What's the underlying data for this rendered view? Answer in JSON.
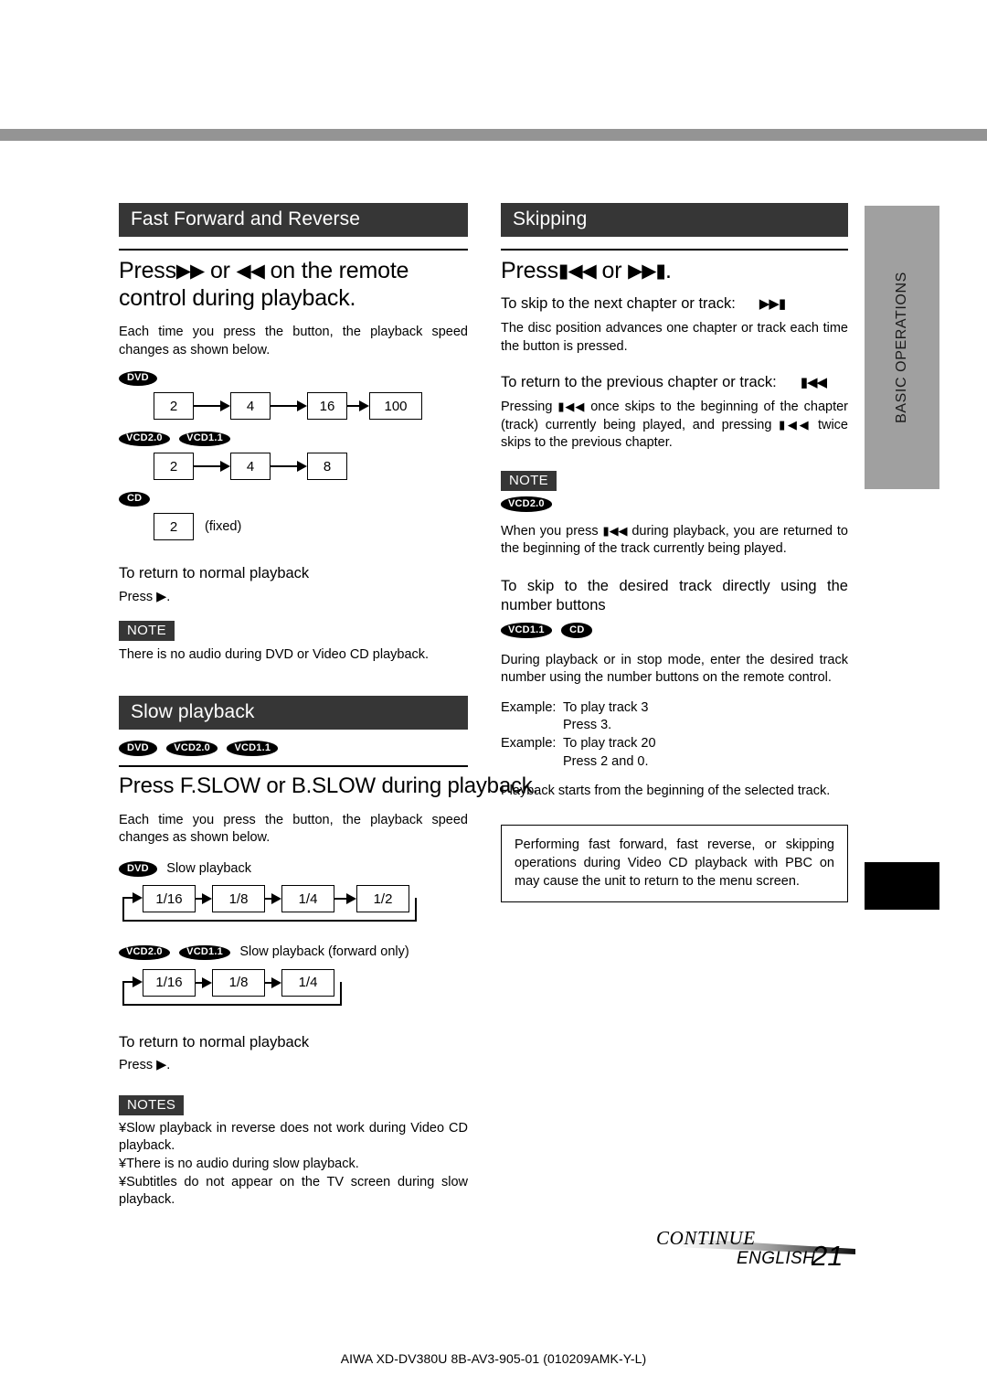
{
  "page": {
    "side_tab_label": "BASIC OPERATIONS",
    "continue_label": "CONTINUE",
    "language_label": "ENGLISH",
    "page_number": "21",
    "footer_code": "AIWA XD-DV380U 8B-AV3-905-01 (010209AMK-Y-L)",
    "accent_dark": "#363636",
    "accent_gray": "#a0a0a0",
    "band_gray": "#949494"
  },
  "left_column": {
    "section1": {
      "title": "Fast Forward and Reverse",
      "headline_prefix": "Press",
      "headline_icon1": "▶▶",
      "headline_mid": " or ",
      "headline_icon2": "◀◀",
      "headline_suffix": " on the remote control during playback.",
      "intro": "Each time you press the button, the playback speed changes as shown below.",
      "diagrams": [
        {
          "badges": [
            "DVD"
          ],
          "steps": [
            "2",
            "4",
            "16",
            "100"
          ],
          "suffix": ""
        },
        {
          "badges": [
            "VCD2.0",
            "VCD1.1"
          ],
          "steps": [
            "2",
            "4",
            "8"
          ],
          "suffix": ""
        },
        {
          "badges": [
            "CD"
          ],
          "steps": [
            "2"
          ],
          "suffix": "(fixed)"
        }
      ],
      "return_heading": "To return to normal playback",
      "return_text": "Press ▶.",
      "note_tag": "NOTE",
      "note_text": "There is no audio during DVD or Video CD playback."
    },
    "section2": {
      "title": "Slow playback",
      "badges": [
        "DVD",
        "VCD2.0",
        "VCD1.1"
      ],
      "headline": "Press F.SLOW or B.SLOW during playback.",
      "intro": "Each time you press the button, the playback speed changes as shown below.",
      "diagram1": {
        "badges": [
          "DVD"
        ],
        "label": "Slow playback",
        "steps": [
          "1/16",
          "1/8",
          "1/4",
          "1/2"
        ]
      },
      "diagram2": {
        "badges": [
          "VCD2.0",
          "VCD1.1"
        ],
        "label": "Slow playback (forward only)",
        "steps": [
          "1/16",
          "1/8",
          "1/4"
        ]
      },
      "return_heading": "To return to normal playback",
      "return_text": "Press ▶.",
      "notes_tag": "NOTES",
      "notes": [
        "Slow playback in reverse does not work during Video CD playback.",
        "There is no audio during slow playback.",
        "Subtitles do not appear on the TV screen during slow playback."
      ],
      "note_bullet": "¥"
    }
  },
  "right_column": {
    "section": {
      "title": "Skipping",
      "headline_prefix": "Press",
      "headline_icon1": "▮◀◀",
      "headline_mid": " or ",
      "headline_icon2": "▶▶▮",
      "headline_suffix": ".",
      "next_heading": "To skip to the next chapter or track:",
      "next_icon": "▶▶▮",
      "next_text": "The disc position advances one chapter or track each time the button is pressed.",
      "prev_heading": "To return to the previous chapter or track:",
      "prev_icon": "▮◀◀",
      "prev_text_a": "Pressing ",
      "prev_icon_inline": "▮◀◀",
      "prev_text_b": " once skips to the beginning of the chapter (track) currently being played, and pressing ",
      "prev_text_c": " twice skips to the previous chapter.",
      "note_tag": "NOTE",
      "note_badges": [
        "VCD2.0"
      ],
      "note_text_a": "When you press ",
      "note_icon": "▮◀◀",
      "note_text_b": " during playback, you are returned to the beginning of the track currently being played.",
      "number_heading": "To skip to the desired track directly using the number buttons",
      "number_badges": [
        "VCD1.1",
        "CD"
      ],
      "number_text": "During playback or in stop mode, enter the desired track number using the number buttons on the remote control.",
      "examples": [
        {
          "label": "Example:",
          "line1": "To play track 3",
          "line2": "Press 3."
        },
        {
          "label": "Example:",
          "line1": "To play track 20",
          "line2": "Press 2 and 0."
        }
      ],
      "after_examples": "Playback starts from the beginning of the selected track.",
      "caution_box": "Performing fast forward, fast reverse, or skipping operations during Video CD playback with PBC on may cause the unit to return to the menu screen."
    }
  }
}
